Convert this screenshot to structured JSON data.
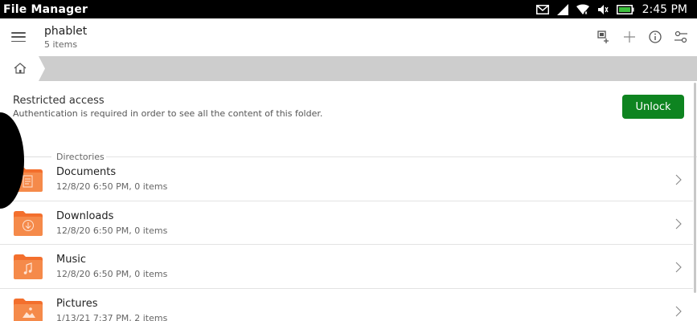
{
  "status_bar": {
    "app_title": "File Manager",
    "clock": "2:45 PM"
  },
  "header": {
    "title": "phablet",
    "subtitle": "5 items"
  },
  "banner": {
    "title": "Restricted access",
    "description": "Authentication is required in order to see all the content of this folder.",
    "unlock_label": "Unlock"
  },
  "section": {
    "label": "Directories"
  },
  "items": [
    {
      "name": "Documents",
      "meta": "12/8/20 6:50 PM, 0 items",
      "icon": "document"
    },
    {
      "name": "Downloads",
      "meta": "12/8/20 6:50 PM, 0 items",
      "icon": "download"
    },
    {
      "name": "Music",
      "meta": "12/8/20 6:50 PM, 0 items",
      "icon": "music"
    },
    {
      "name": "Pictures",
      "meta": "1/13/21 7:37 PM, 2 items",
      "icon": "picture"
    }
  ],
  "colors": {
    "accent": "#0e8420",
    "folder": "#f36f2d",
    "pathbar": "#cdcdcd"
  }
}
